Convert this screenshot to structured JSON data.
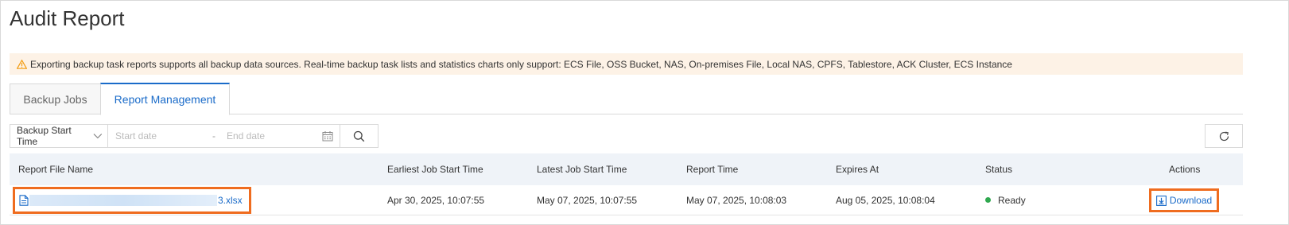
{
  "page": {
    "title": "Audit Report"
  },
  "alert": {
    "text": "Exporting backup task reports supports all backup data sources. Real-time backup task lists and statistics charts only support: ECS File, OSS Bucket, NAS, On-premises File, Local NAS, CPFS, Tablestore, ACK Cluster, ECS Instance",
    "icon": "warning-icon",
    "color": "#f39c12"
  },
  "tabs": [
    {
      "label": "Backup Jobs",
      "active": false
    },
    {
      "label": "Report Management",
      "active": true
    }
  ],
  "filters": {
    "time_field": "Backup Start Time",
    "start_placeholder": "Start date",
    "separator": "-",
    "end_placeholder": "End date"
  },
  "table": {
    "columns": [
      "Report File Name",
      "Earliest Job Start Time",
      "Latest Job Start Time",
      "Report Time",
      "Expires At",
      "Status",
      "Actions"
    ],
    "rows": [
      {
        "file_prefix": "",
        "file_suffix": "3.xlsx",
        "earliest": "Apr 30, 2025, 10:07:55",
        "latest": "May 07, 2025, 10:07:55",
        "report_time": "May 07, 2025, 10:08:03",
        "expires": "Aug 05, 2025, 10:08:04",
        "status": "Ready",
        "action": "Download"
      }
    ]
  },
  "colors": {
    "accent": "#1a6bc9",
    "highlight": "#ef6c1f",
    "ready": "#2fa84f",
    "alert_bg": "#fdf2e6"
  }
}
